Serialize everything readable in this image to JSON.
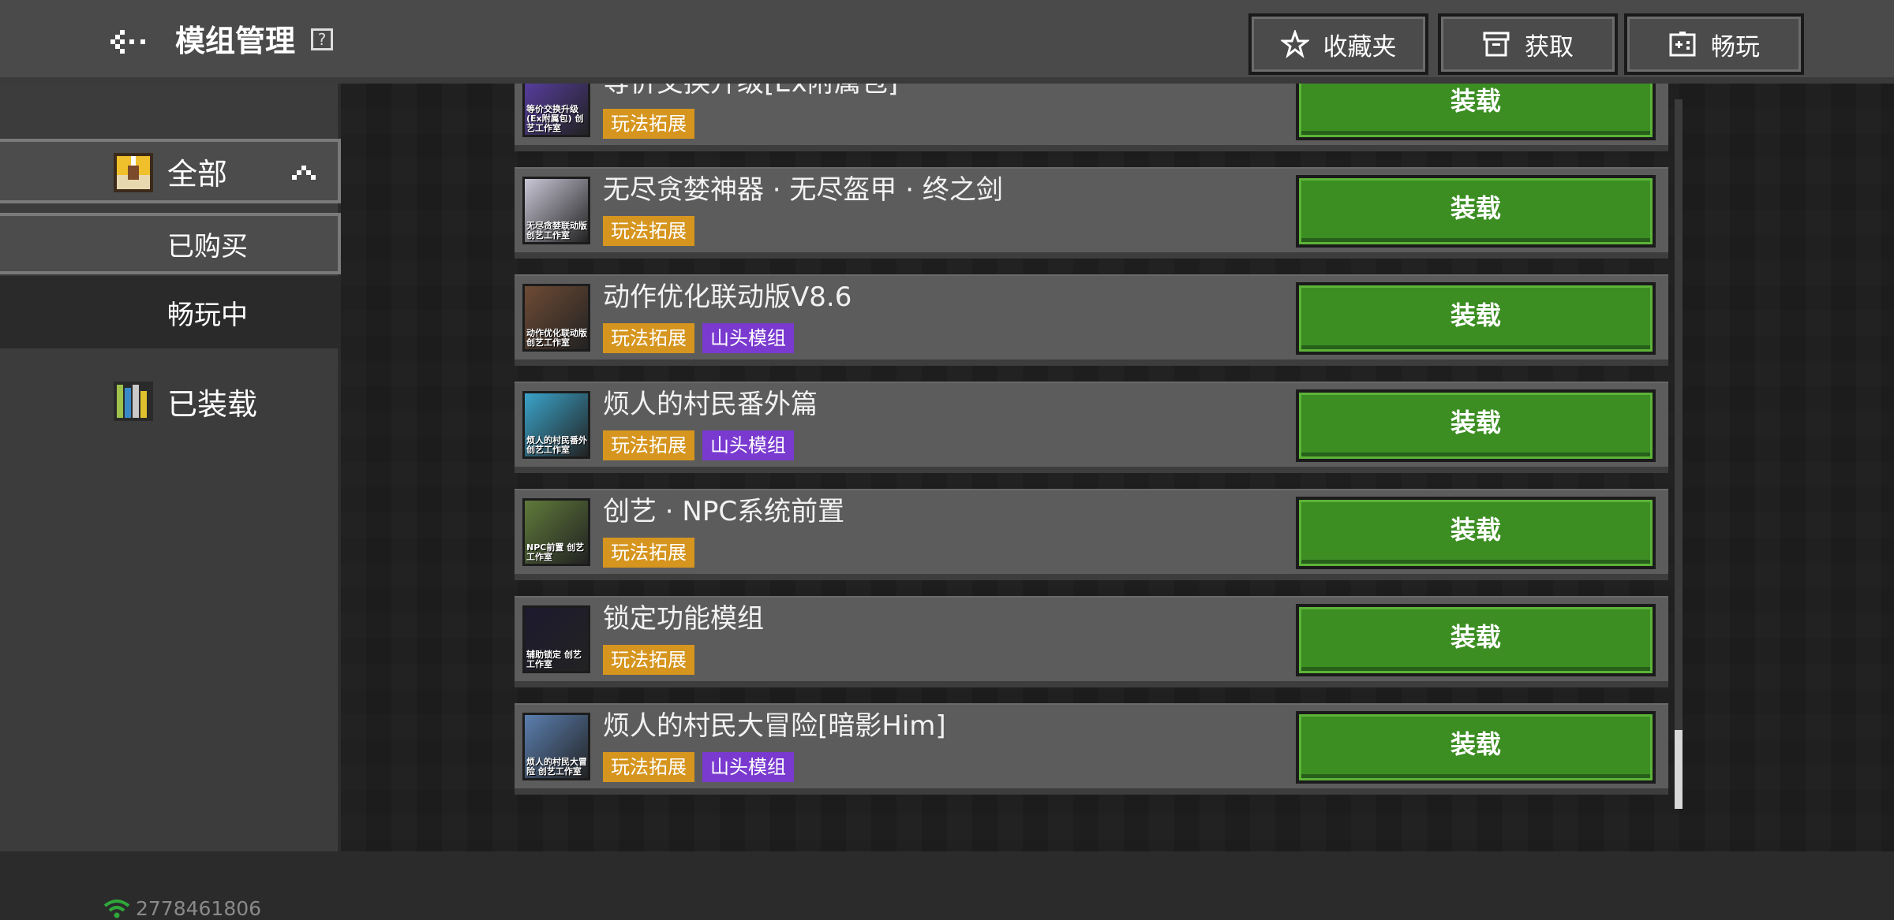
{
  "header": {
    "title": "模组管理",
    "help": "?",
    "buttons": [
      {
        "label": "收藏夹",
        "icon": "star-icon"
      },
      {
        "label": "获取",
        "icon": "archive-icon"
      },
      {
        "label": "畅玩",
        "icon": "gamepad-icon"
      }
    ]
  },
  "sidebar": {
    "all": "全部",
    "bought": "已购买",
    "playing": "畅玩中",
    "loaded": "已装载",
    "net_id": "2778461806"
  },
  "mods": [
    {
      "title": "等价交换升级[Ex附属包]",
      "tags": [
        "玩法拓展"
      ],
      "thumb_caption": "等价交换升级(Ex附属包) 创艺工作室",
      "thumb_color": "#5a3fa8",
      "action": "装载"
    },
    {
      "title": "无尽贪婪神器 · 无尽盔甲 · 终之剑",
      "tags": [
        "玩法拓展"
      ],
      "thumb_caption": "无尽贪婪联动版 创艺工作室",
      "thumb_color": "#c9c7d6",
      "action": "装载"
    },
    {
      "title": "动作优化联动版V8.6",
      "tags": [
        "玩法拓展",
        "山头模组"
      ],
      "thumb_caption": "动作优化联动版 创艺工作室",
      "thumb_color": "#6e4b35",
      "action": "装载"
    },
    {
      "title": "烦人的村民番外篇",
      "tags": [
        "玩法拓展",
        "山头模组"
      ],
      "thumb_caption": "烦人的村民番外 创艺工作室",
      "thumb_color": "#3aa3c9",
      "action": "装载"
    },
    {
      "title": "创艺 · NPC系统前置",
      "tags": [
        "玩法拓展"
      ],
      "thumb_caption": "NPC前置 创艺工作室",
      "thumb_color": "#5f7a3a",
      "action": "装载"
    },
    {
      "title": "锁定功能模组",
      "tags": [
        "玩法拓展"
      ],
      "thumb_caption": "辅助锁定 创艺工作室",
      "thumb_color": "#1d1a2e",
      "action": "装载"
    },
    {
      "title": "烦人的村民大冒险[暗影Him]",
      "tags": [
        "玩法拓展",
        "山头模组"
      ],
      "thumb_caption": "烦人的村民大冒险 创艺工作室",
      "thumb_color": "#5b7fb0",
      "action": "装载"
    }
  ],
  "tag_colors": {
    "玩法拓展": "gold",
    "山头模组": "purple"
  },
  "colors": {
    "load_button": "#3c8e23",
    "tag_gold": "#d6951e",
    "tag_purple": "#7a3ad0"
  }
}
